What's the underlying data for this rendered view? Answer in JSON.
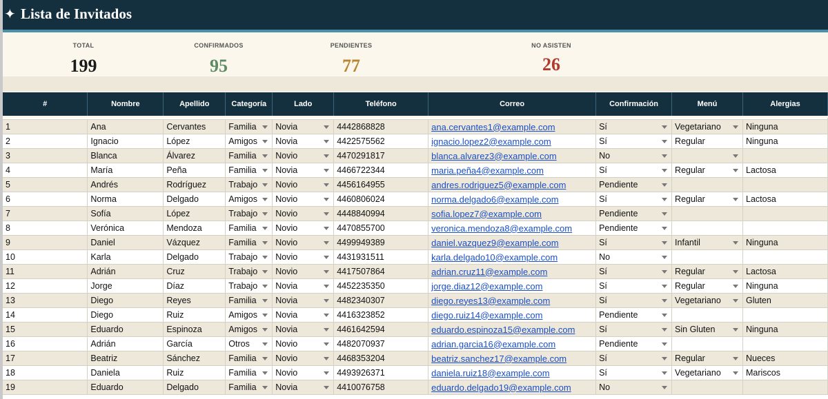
{
  "header": {
    "star_icon": "✦",
    "title": "Lista de Invitados"
  },
  "summary": {
    "total_label": "TOTAL",
    "total_value": "199",
    "confirmed_label": "CONFIRMADOS",
    "confirmed_value": "95",
    "pending_label": "PENDIENTES",
    "pending_value": "77",
    "declined_label": "NO ASISTEN",
    "declined_value": "26",
    "colors": {
      "total": "#1a1a1a",
      "confirmed": "#5b8a63",
      "pending": "#b8842e",
      "declined": "#b03a2e"
    }
  },
  "columns": [
    "#",
    "Nombre",
    "Apellido",
    "Categoría",
    "Lado",
    "Teléfono",
    "Correo",
    "Confirmación",
    "Menú",
    "Alergias"
  ],
  "rows": [
    {
      "n": "1",
      "nombre": "Ana",
      "apellido": "Cervantes",
      "categoria": "Familia",
      "lado": "Novia",
      "telefono": "4442868828",
      "correo": "ana.cervantes1@example.com",
      "confirmacion": "Sí",
      "menu": "Vegetariano",
      "alergias": "Ninguna"
    },
    {
      "n": "2",
      "nombre": "Ignacio",
      "apellido": "López",
      "categoria": "Amigos",
      "lado": "Novia",
      "telefono": "4422575562",
      "correo": "ignacio.lopez2@example.com",
      "confirmacion": "Sí",
      "menu": "Regular",
      "alergias": "Ninguna"
    },
    {
      "n": "3",
      "nombre": "Blanca",
      "apellido": "Álvarez",
      "categoria": "Familia",
      "lado": "Novio",
      "telefono": "4470291817",
      "correo": "blanca.alvarez3@example.com",
      "confirmacion": "No",
      "menu": "",
      "alergias": ""
    },
    {
      "n": "4",
      "nombre": "María",
      "apellido": "Peña",
      "categoria": "Familia",
      "lado": "Novia",
      "telefono": "4466722344",
      "correo": "maria.peña4@example.com",
      "confirmacion": "Sí",
      "menu": "Regular",
      "alergias": "Lactosa"
    },
    {
      "n": "5",
      "nombre": "Andrés",
      "apellido": "Rodríguez",
      "categoria": "Trabajo",
      "lado": "Novio",
      "telefono": "4456164955",
      "correo": "andres.rodriguez5@example.com",
      "confirmacion": "Pendiente",
      "menu": "",
      "alergias": ""
    },
    {
      "n": "6",
      "nombre": "Norma",
      "apellido": "Delgado",
      "categoria": "Amigos",
      "lado": "Novio",
      "telefono": "4460806024",
      "correo": "norma.delgado6@example.com",
      "confirmacion": "Sí",
      "menu": "Regular",
      "alergias": "Lactosa"
    },
    {
      "n": "7",
      "nombre": "Sofía",
      "apellido": "López",
      "categoria": "Trabajo",
      "lado": "Novio",
      "telefono": "4448840994",
      "correo": "sofia.lopez7@example.com",
      "confirmacion": "Pendiente",
      "menu": "",
      "alergias": ""
    },
    {
      "n": "8",
      "nombre": "Verónica",
      "apellido": "Mendoza",
      "categoria": "Familia",
      "lado": "Novio",
      "telefono": "4470855700",
      "correo": "veronica.mendoza8@example.com",
      "confirmacion": "Pendiente",
      "menu": "",
      "alergias": ""
    },
    {
      "n": "9",
      "nombre": "Daniel",
      "apellido": "Vázquez",
      "categoria": "Familia",
      "lado": "Novio",
      "telefono": "4499949389",
      "correo": "daniel.vazquez9@example.com",
      "confirmacion": "Sí",
      "menu": "Infantil",
      "alergias": "Ninguna"
    },
    {
      "n": "10",
      "nombre": "Karla",
      "apellido": "Delgado",
      "categoria": "Trabajo",
      "lado": "Novio",
      "telefono": "4431931511",
      "correo": "karla.delgado10@example.com",
      "confirmacion": "No",
      "menu": "",
      "alergias": ""
    },
    {
      "n": "11",
      "nombre": "Adrián",
      "apellido": "Cruz",
      "categoria": "Trabajo",
      "lado": "Novio",
      "telefono": "4417507864",
      "correo": "adrian.cruz11@example.com",
      "confirmacion": "Sí",
      "menu": "Regular",
      "alergias": "Lactosa"
    },
    {
      "n": "12",
      "nombre": "Jorge",
      "apellido": "Díaz",
      "categoria": "Trabajo",
      "lado": "Novia",
      "telefono": "4452235350",
      "correo": "jorge.diaz12@example.com",
      "confirmacion": "Sí",
      "menu": "Regular",
      "alergias": "Ninguna"
    },
    {
      "n": "13",
      "nombre": "Diego",
      "apellido": "Reyes",
      "categoria": "Familia",
      "lado": "Novia",
      "telefono": "4482340307",
      "correo": "diego.reyes13@example.com",
      "confirmacion": "Sí",
      "menu": "Vegetariano",
      "alergias": "Gluten"
    },
    {
      "n": "14",
      "nombre": "Diego",
      "apellido": "Ruiz",
      "categoria": "Amigos",
      "lado": "Novia",
      "telefono": "4416323852",
      "correo": "diego.ruiz14@example.com",
      "confirmacion": "Pendiente",
      "menu": "",
      "alergias": ""
    },
    {
      "n": "15",
      "nombre": "Eduardo",
      "apellido": "Espinoza",
      "categoria": "Amigos",
      "lado": "Novia",
      "telefono": "4461642594",
      "correo": "eduardo.espinoza15@example.com",
      "confirmacion": "Sí",
      "menu": "Sin Gluten",
      "alergias": "Ninguna"
    },
    {
      "n": "16",
      "nombre": "Adrián",
      "apellido": "García",
      "categoria": "Otros",
      "lado": "Novio",
      "telefono": "4482070937",
      "correo": "adrian.garcia16@example.com",
      "confirmacion": "Pendiente",
      "menu": "",
      "alergias": ""
    },
    {
      "n": "17",
      "nombre": "Beatriz",
      "apellido": "Sánchez",
      "categoria": "Familia",
      "lado": "Novio",
      "telefono": "4468353204",
      "correo": "beatriz.sanchez17@example.com",
      "confirmacion": "Sí",
      "menu": "Regular",
      "alergias": "Nueces"
    },
    {
      "n": "18",
      "nombre": "Daniela",
      "apellido": "Ruiz",
      "categoria": "Familia",
      "lado": "Novio",
      "telefono": "4493926371",
      "correo": "daniela.ruiz18@example.com",
      "confirmacion": "Sí",
      "menu": "Vegetariano",
      "alergias": "Mariscos"
    },
    {
      "n": "19",
      "nombre": "Eduardo",
      "apellido": "Delgado",
      "categoria": "Familia",
      "lado": "Novia",
      "telefono": "4410076758",
      "correo": "eduardo.delgado19@example.com",
      "confirmacion": "No",
      "menu": "",
      "alergias": ""
    }
  ]
}
